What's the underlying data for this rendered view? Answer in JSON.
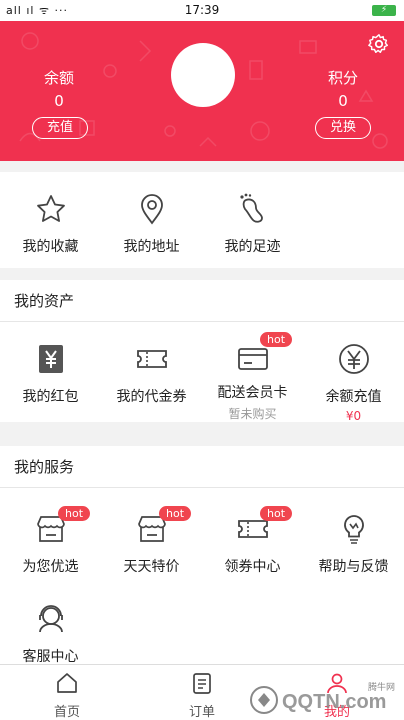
{
  "status_bar": {
    "left": "all ıl ᯤ ···",
    "time": "17:39",
    "battery": "⚡"
  },
  "header": {
    "balance_label": "余额",
    "balance_value": "0",
    "recharge_button": "充值",
    "points_label": "积分",
    "points_value": "0",
    "exchange_button": "兑换",
    "accent_color": "#f0314f"
  },
  "quick_links": [
    {
      "label": "我的收藏",
      "icon": "star-icon"
    },
    {
      "label": "我的地址",
      "icon": "location-pin-icon"
    },
    {
      "label": "我的足迹",
      "icon": "footprint-icon"
    }
  ],
  "assets": {
    "title": "我的资产",
    "items": [
      {
        "label": "我的红包",
        "icon": "yen-redpacket-icon"
      },
      {
        "label": "我的代金券",
        "icon": "voucher-icon"
      },
      {
        "label": "配送会员卡",
        "icon": "card-icon",
        "badge": "hot",
        "sub": "暂未购买"
      },
      {
        "label": "余额充值",
        "icon": "yen-circle-icon",
        "sub": "¥0"
      }
    ]
  },
  "services": {
    "title": "我的服务",
    "items": [
      {
        "label": "为您优选",
        "icon": "shop-icon",
        "badge": "hot"
      },
      {
        "label": "天天特价",
        "icon": "shop-icon",
        "badge": "hot"
      },
      {
        "label": "领券中心",
        "icon": "ticket-icon",
        "badge": "hot"
      },
      {
        "label": "帮助与反馈",
        "icon": "lightbulb-icon"
      },
      {
        "label": "客服中心",
        "icon": "customer-service-icon"
      }
    ]
  },
  "tabs": [
    {
      "label": "首页",
      "icon": "home-icon"
    },
    {
      "label": "订单",
      "icon": "order-icon"
    },
    {
      "label": "我的",
      "icon": "user-icon"
    }
  ],
  "watermark": {
    "text": "QQTN.com",
    "sub": "腾牛网"
  }
}
